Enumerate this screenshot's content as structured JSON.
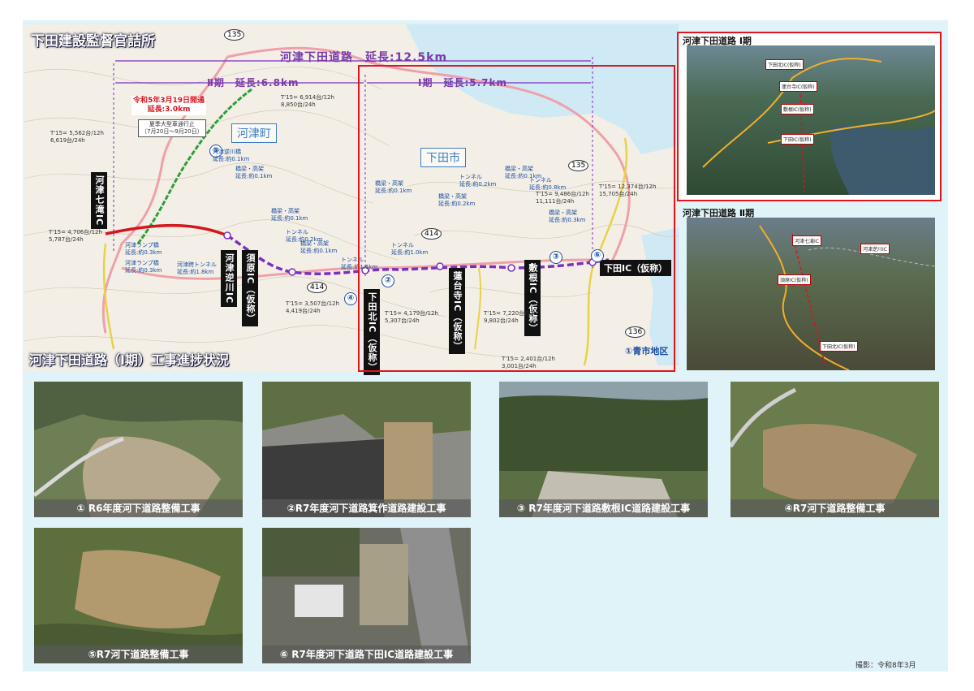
{
  "office_title": "下田建設監督官詰所",
  "progress_title": "河津下田道路（Ⅰ期）工事進捗状況",
  "route": {
    "total": "河津下田道路　延長:12.5km",
    "phase1": "Ⅰ期　延長:5.7km",
    "phase2": "Ⅱ期　延長:6.8km",
    "opened_line1": "令和5年3月19日開通",
    "opened_line2": "延長:3.0km",
    "restriction": "夏季大型車通行止\n（7月20日～9月20日）"
  },
  "towns": {
    "kawazu": "河津町",
    "shimoda": "下田市",
    "aoichi": "①青市地区"
  },
  "ic_labels": {
    "kawazu_nanadaru": "河津七滝IC",
    "kawazu_sakasagawa": "河津逆川IC",
    "suhara": "須原IC（仮称）",
    "shimoda_kita": "下田北IC（仮称）",
    "rendaiji": "蓮台寺IC（仮称）",
    "shikine": "敷根IC（仮称）",
    "shimoda": "下田IC（仮称）"
  },
  "road_numbers": [
    "135",
    "414",
    "414",
    "136",
    "135"
  ],
  "markers": [
    "⑤",
    "④",
    "②",
    "③",
    "⑥"
  ],
  "traffic_notes": [
    "T'15= 5,562台/12h\n6,619台/24h",
    "T'15= 6,914台/12h\n8,850台/24h",
    "T'15= 4,706台/12h\n5,787台/24h",
    "T'15= 3,507台/12h\n4,419台/24h",
    "T'15= 4,179台/12h\n5,307台/24h",
    "T'15= 7,220台/12h\n9,802台/24h",
    "T'15= 9,486台/12h\n11,111台/24h",
    "T'15= 12,374台/12h\n15,705台/24h",
    "T'15= 2,401台/12h\n3,001台/24h"
  ],
  "structure_notes": [
    "河津逆川橋\n延長:約0.1km",
    "橋梁・高架\n延長:約0.1km",
    "橋梁・高架\n延長:約0.1km",
    "トンネル\n延長:約0.2km",
    "橋梁・高架\n延長:約0.1km",
    "トンネル\n延長:約1.5km",
    "橋梁・高架\n延長:約0.1km",
    "トンネル\n延長:約1.0km",
    "トンネル\n延長:約0.2km",
    "橋梁・高架\n延長:約0.2km",
    "橋梁・高架\n延長:約0.1km",
    "トンネル\n延長:約0.8km",
    "橋梁・高架\n延長:約0.3km",
    "河津ランプ橋\n延長:約0.3km",
    "河津ランプ橋\n延長:約0.3km",
    "河津跨トンネル\n延長:約1.8km"
  ],
  "aerial": {
    "phase1_title": "河津下田道路 Ⅰ期",
    "phase2_title": "河津下田道路 Ⅱ期",
    "phase1_points": [
      "下田北IC(仮称)",
      "蓮台寺IC(仮称)",
      "敷根IC(仮称)",
      "下田IC(仮称)"
    ],
    "phase2_points": [
      "河津七滝IC",
      "河津逆川IC",
      "須原IC(仮称)",
      "下田北IC(仮称)"
    ]
  },
  "photos": [
    {
      "caption": "① R6年度河下道路整備工事"
    },
    {
      "caption": "②R7年度河下道路箕作道路建設工事"
    },
    {
      "caption": "③ R7年度河下道路敷根IC道路建設工事"
    },
    {
      "caption": "④R7河下道路整備工事"
    },
    {
      "caption": "⑤R7河下道路整備工事"
    },
    {
      "caption": "⑥ R7年度河下道路下田IC道路建設工事"
    }
  ],
  "credit": "撮影：令和8年3月",
  "colors": {
    "phase1_route": "#7b2fbf",
    "opened_route": "#d6151d",
    "frame": "#e0141d",
    "sheet": "#dff3f8"
  }
}
